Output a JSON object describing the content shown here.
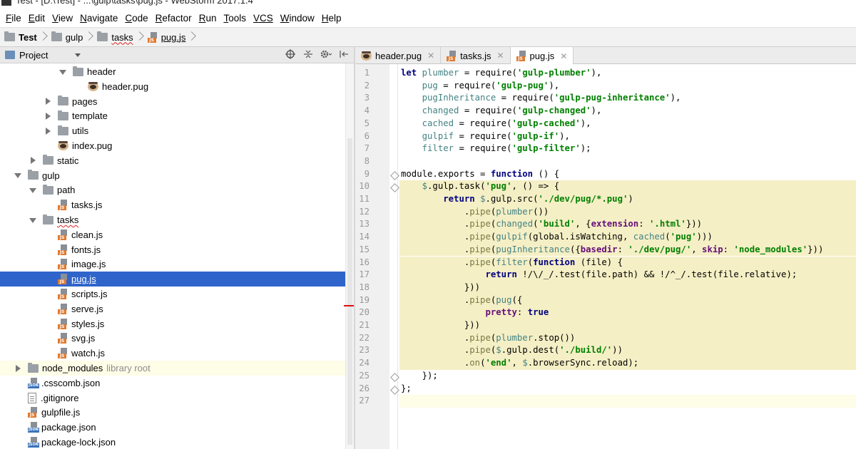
{
  "window": {
    "title": "Test - [D:\\Test] - ...\\gulp\\tasks\\pug.js - WebStorm 2017.1.4"
  },
  "menu": [
    {
      "mn": "F",
      "rest": "ile"
    },
    {
      "mn": "E",
      "rest": "dit"
    },
    {
      "mn": "V",
      "rest": "iew"
    },
    {
      "mn": "N",
      "rest": "avigate"
    },
    {
      "mn": "C",
      "rest": "ode"
    },
    {
      "mn": "R",
      "rest": "efactor"
    },
    {
      "mn": "R",
      "rest": "un"
    },
    {
      "mn": "T",
      "rest": "ools"
    },
    {
      "mn": "VCS",
      "rest": ""
    },
    {
      "mn": "W",
      "rest": "indow"
    },
    {
      "mn": "H",
      "rest": "elp"
    }
  ],
  "breadcrumb": [
    "Test",
    "gulp",
    "tasks",
    "pug.js"
  ],
  "project_panel": {
    "label": "Project"
  },
  "tree": [
    {
      "indent": 3,
      "arrow": "down",
      "icon": "folder",
      "label": "header"
    },
    {
      "indent": 4,
      "arrow": "none",
      "icon": "pug",
      "label": "header.pug"
    },
    {
      "indent": 2,
      "arrow": "right",
      "icon": "folder",
      "label": "pages"
    },
    {
      "indent": 2,
      "arrow": "right",
      "icon": "folder",
      "label": "template"
    },
    {
      "indent": 2,
      "arrow": "right",
      "icon": "folder",
      "label": "utils"
    },
    {
      "indent": 2,
      "arrow": "none",
      "icon": "pug",
      "label": "index.pug"
    },
    {
      "indent": 1,
      "arrow": "right",
      "icon": "folder",
      "label": "static"
    },
    {
      "indent": 0,
      "arrow": "down",
      "icon": "folder",
      "label": "gulp"
    },
    {
      "indent": 1,
      "arrow": "down",
      "icon": "folder",
      "label": "path"
    },
    {
      "indent": 2,
      "arrow": "none",
      "icon": "js",
      "label": "tasks.js"
    },
    {
      "indent": 1,
      "arrow": "down",
      "icon": "folder",
      "label": "tasks",
      "spell": true
    },
    {
      "indent": 2,
      "arrow": "none",
      "icon": "js",
      "label": "clean.js"
    },
    {
      "indent": 2,
      "arrow": "none",
      "icon": "js",
      "label": "fonts.js"
    },
    {
      "indent": 2,
      "arrow": "none",
      "icon": "js",
      "label": "image.js"
    },
    {
      "indent": 2,
      "arrow": "none",
      "icon": "js",
      "label": "pug.js",
      "selected": true
    },
    {
      "indent": 2,
      "arrow": "none",
      "icon": "js",
      "label": "scripts.js"
    },
    {
      "indent": 2,
      "arrow": "none",
      "icon": "js",
      "label": "serve.js"
    },
    {
      "indent": 2,
      "arrow": "none",
      "icon": "js",
      "label": "styles.js"
    },
    {
      "indent": 2,
      "arrow": "none",
      "icon": "js",
      "label": "svg.js"
    },
    {
      "indent": 2,
      "arrow": "none",
      "icon": "js",
      "label": "watch.js"
    },
    {
      "indent": 0,
      "arrow": "right",
      "icon": "folder",
      "label": "node_modules",
      "muted": "library root",
      "highlight": true
    },
    {
      "indent": 0,
      "arrow": "none",
      "icon": "json",
      "label": ".csscomb.json"
    },
    {
      "indent": 0,
      "arrow": "none",
      "icon": "file",
      "label": ".gitignore"
    },
    {
      "indent": 0,
      "arrow": "none",
      "icon": "js",
      "label": "gulpfile.js"
    },
    {
      "indent": 0,
      "arrow": "none",
      "icon": "json",
      "label": "package.json"
    },
    {
      "indent": 0,
      "arrow": "none",
      "icon": "json",
      "label": "package-lock.json"
    }
  ],
  "tabs": [
    {
      "label": "header.pug",
      "icon": "pug",
      "active": false
    },
    {
      "label": "tasks.js",
      "icon": "js",
      "active": false
    },
    {
      "label": "pug.js",
      "icon": "js",
      "active": true
    }
  ],
  "code": [
    [
      [
        "kw",
        "let"
      ],
      [
        "",
        " "
      ],
      [
        "var",
        "plumber"
      ],
      [
        "",
        " = require("
      ],
      [
        "str",
        "'gulp-plumber'"
      ],
      [
        "",
        "),"
      ]
    ],
    [
      [
        "",
        "    "
      ],
      [
        "var",
        "pug"
      ],
      [
        "",
        " = require("
      ],
      [
        "str",
        "'gulp-pug'"
      ],
      [
        "",
        "),"
      ]
    ],
    [
      [
        "",
        "    "
      ],
      [
        "var",
        "pugInheritance"
      ],
      [
        "",
        " = require("
      ],
      [
        "str",
        "'gulp-pug-inheritance'"
      ],
      [
        "",
        "),"
      ]
    ],
    [
      [
        "",
        "    "
      ],
      [
        "var",
        "changed"
      ],
      [
        "",
        " = require("
      ],
      [
        "str",
        "'gulp-changed'"
      ],
      [
        "",
        "),"
      ]
    ],
    [
      [
        "",
        "    "
      ],
      [
        "var",
        "cached"
      ],
      [
        "",
        " = require("
      ],
      [
        "str",
        "'gulp-cached'"
      ],
      [
        "",
        "),"
      ]
    ],
    [
      [
        "",
        "    "
      ],
      [
        "var",
        "gulpif"
      ],
      [
        "",
        " = require("
      ],
      [
        "str",
        "'gulp-if'"
      ],
      [
        "",
        "),"
      ]
    ],
    [
      [
        "",
        "    "
      ],
      [
        "var",
        "filter"
      ],
      [
        "",
        " = require("
      ],
      [
        "str",
        "'gulp-filter'"
      ],
      [
        "",
        ");"
      ]
    ],
    [],
    [
      [
        "",
        "module.exports = "
      ],
      [
        "kw",
        "function"
      ],
      [
        "",
        " () {"
      ]
    ],
    [
      [
        "",
        "    "
      ],
      [
        "var",
        "$"
      ],
      [
        "",
        ".gulp.task("
      ],
      [
        "str",
        "'pug'"
      ],
      [
        "",
        ", () => {"
      ]
    ],
    [
      [
        "",
        "        "
      ],
      [
        "kw",
        "return"
      ],
      [
        "",
        " "
      ],
      [
        "var",
        "$"
      ],
      [
        "",
        ".gulp.src("
      ],
      [
        "str",
        "'./dev/pug/*.pug'"
      ],
      [
        "",
        ")"
      ]
    ],
    [
      [
        "",
        "            ."
      ],
      [
        "fn",
        "pipe"
      ],
      [
        "",
        "("
      ],
      [
        "var",
        "plumber"
      ],
      [
        "",
        "())"
      ]
    ],
    [
      [
        "",
        "            ."
      ],
      [
        "fn",
        "pipe"
      ],
      [
        "",
        "("
      ],
      [
        "var",
        "changed"
      ],
      [
        "",
        "("
      ],
      [
        "str",
        "'build'"
      ],
      [
        "",
        ", {"
      ],
      [
        "prop",
        "extension"
      ],
      [
        "",
        ": "
      ],
      [
        "str",
        "'.html'"
      ],
      [
        "",
        "}))"
      ]
    ],
    [
      [
        "",
        "            ."
      ],
      [
        "fn",
        "pipe"
      ],
      [
        "",
        "("
      ],
      [
        "var",
        "gulpif"
      ],
      [
        "",
        "(global.isWatching, "
      ],
      [
        "var",
        "cached"
      ],
      [
        "",
        "("
      ],
      [
        "str",
        "'pug'"
      ],
      [
        "",
        ")))"
      ]
    ],
    [
      [
        "",
        "            ."
      ],
      [
        "fn",
        "pipe"
      ],
      [
        "",
        "("
      ],
      [
        "var",
        "pugInheritance"
      ],
      [
        "",
        "({"
      ],
      [
        "prop",
        "basedir"
      ],
      [
        "",
        ": "
      ],
      [
        "str",
        "'./dev/pug/'"
      ],
      [
        "",
        ", "
      ],
      [
        "prop",
        "skip"
      ],
      [
        "",
        ": "
      ],
      [
        "str",
        "'node_modules'"
      ],
      [
        "",
        "}))"
      ]
    ],
    [
      [
        "",
        "            ."
      ],
      [
        "fn",
        "pipe"
      ],
      [
        "",
        "("
      ],
      [
        "var",
        "filter"
      ],
      [
        "",
        "("
      ],
      [
        "kw",
        "function"
      ],
      [
        "",
        " (file) {"
      ]
    ],
    [
      [
        "",
        "                "
      ],
      [
        "kw",
        "return"
      ],
      [
        "",
        " !/\\/_/.test(file.path) && !/^_/.test(file.relative);"
      ]
    ],
    [
      [
        "",
        "            }))"
      ]
    ],
    [
      [
        "",
        "            ."
      ],
      [
        "fn",
        "pipe"
      ],
      [
        "",
        "("
      ],
      [
        "var",
        "pug"
      ],
      [
        "",
        "({"
      ]
    ],
    [
      [
        "",
        "                "
      ],
      [
        "prop",
        "pretty"
      ],
      [
        "",
        ": "
      ],
      [
        "kw",
        "true"
      ]
    ],
    [
      [
        "",
        "            }))"
      ]
    ],
    [
      [
        "",
        "            ."
      ],
      [
        "fn",
        "pipe"
      ],
      [
        "",
        "("
      ],
      [
        "var",
        "plumber"
      ],
      [
        "",
        ".stop())"
      ]
    ],
    [
      [
        "",
        "            ."
      ],
      [
        "fn",
        "pipe"
      ],
      [
        "",
        "("
      ],
      [
        "var",
        "$"
      ],
      [
        "",
        ".gulp.dest("
      ],
      [
        "str",
        "'./build/'"
      ],
      [
        "",
        "))"
      ]
    ],
    [
      [
        "",
        "            ."
      ],
      [
        "fn",
        "on"
      ],
      [
        "",
        "("
      ],
      [
        "str",
        "'end'"
      ],
      [
        "",
        ", "
      ],
      [
        "var",
        "$"
      ],
      [
        "",
        ".browserSync.reload);"
      ]
    ],
    [
      [
        "",
        "    });"
      ]
    ],
    [
      [
        "",
        "};"
      ]
    ],
    []
  ]
}
